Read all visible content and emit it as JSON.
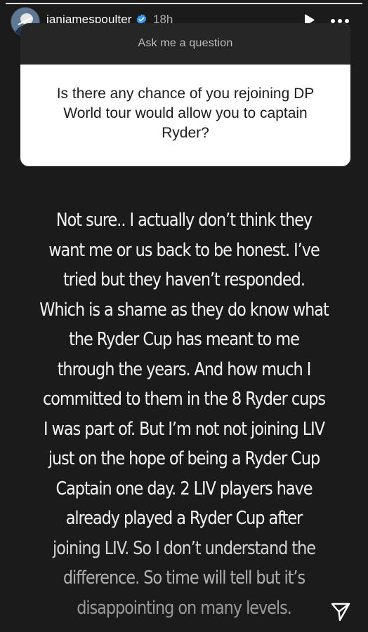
{
  "header": {
    "username": "ianjamespoulter",
    "time_ago": "18h",
    "verified": true,
    "progress_fraction": 1.0
  },
  "question_sticker": {
    "title": "Ask me a question",
    "question": "Is there any chance of you rejoining DP World tour would allow you to captain Ryder?"
  },
  "answer": {
    "lines": [
      "Not sure.. I actually don’t think they",
      "want me or us back to be honest. I’ve",
      "tried but they haven’t responded.",
      "Which is a shame as they do know what",
      "the Ryder Cup has meant to me",
      "through the years. And how much I",
      "committed to them in the 8 Ryder cups",
      "I was part of. But I’m not not joining LIV",
      "just on the hope of being a Ryder Cup",
      "Captain one day. 2 LIV players have",
      "already played a Ryder Cup after",
      "joining LIV. So I don’t understand the",
      "difference. So time will tell but it’s",
      "disappointing on many levels."
    ]
  },
  "icons": {
    "verified": "verified-badge-icon",
    "play": "play-icon",
    "more": "more-options-icon",
    "share": "share-icon"
  },
  "colors": {
    "background": "#1b1b1b",
    "verified_blue": "#3897f0",
    "question_header": "#262626",
    "question_body": "#ffffff"
  }
}
